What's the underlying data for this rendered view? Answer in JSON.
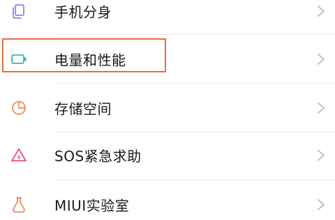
{
  "settings": {
    "items": [
      {
        "label": "手机分身",
        "icon": "clone-phone-icon",
        "icon_color": "#9b7be0"
      },
      {
        "label": "电量和性能",
        "icon": "battery-icon",
        "icon_color": "#2fb9a6"
      },
      {
        "label": "存储空间",
        "icon": "storage-pie-icon",
        "icon_color": "#f08a5d"
      },
      {
        "label": "SOS紧急求助",
        "icon": "sos-warning-icon",
        "icon_color": "#e0567a"
      },
      {
        "label": "MIUI实验室",
        "icon": "lab-flask-icon",
        "icon_color": "#f0865a"
      }
    ]
  },
  "highlight": {
    "target": "电量和性能",
    "color": "#ef6a3a"
  }
}
